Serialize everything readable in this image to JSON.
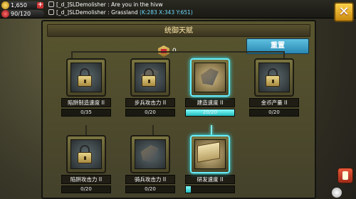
{
  "hud": {
    "gold": "1,650",
    "health": "90/120",
    "plus_label": "+"
  },
  "chat": {
    "line1": "[_d_]SLDemolisher : Are you in the hivw",
    "line2_text": "[_d_]SLDemolisher : Grassland ",
    "line2_coord": "(K:283 X:343 Y:651)"
  },
  "close_label": "✕",
  "panel": {
    "title": "统御天赋",
    "points": "0",
    "reset_label": "重置"
  },
  "talents": [
    {
      "name": "陷阱制造速度 II",
      "progress": "0/35",
      "fill": 0,
      "icon": "lock-icon",
      "active": false
    },
    {
      "name": "步兵攻击力 II",
      "progress": "0/20",
      "fill": 0,
      "icon": "lock-icon",
      "active": false
    },
    {
      "name": "建造速度 II",
      "progress": "20/20",
      "fill": 1,
      "icon": "hammer-icon",
      "active": true
    },
    {
      "name": "金币产量 II",
      "progress": "0/20",
      "fill": 0,
      "icon": "lock-icon",
      "active": false
    },
    {
      "name": "陷阱攻击力 II",
      "progress": "0/20",
      "fill": 0,
      "icon": "lock-icon",
      "active": false
    },
    {
      "name": "骑兵攻击力 II",
      "progress": "0/20",
      "fill": 0,
      "icon": "horse-icon",
      "active": false
    },
    {
      "name": "研发速度 II",
      "progress": "",
      "fill": 0.1,
      "icon": "book-icon",
      "active": true
    }
  ],
  "colors": {
    "accent": "#5ec0e0",
    "active_glow": "#7fe8e8",
    "coord": "#6fd9ff"
  }
}
